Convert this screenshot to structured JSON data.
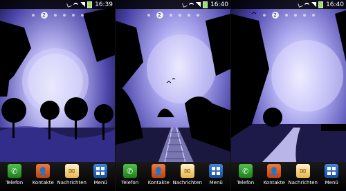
{
  "screens": [
    {
      "time": "16:39",
      "current_page": "2"
    },
    {
      "time": "16:40",
      "current_page": "2"
    },
    {
      "time": "16:40",
      "current_page": "2"
    }
  ],
  "dock": {
    "phone_label": "Telefon",
    "contacts_label": "Kontakte",
    "messages_label": "Nachrichten",
    "menu_label": "Menü"
  },
  "colors": {
    "sky": "#6a63c8",
    "moon_glow": "#e8e8ff",
    "phone_green": "#2e9b29",
    "contacts_orange": "#e0612a",
    "menu_blue": "#2a6ac4"
  },
  "icons": [
    "usb-icon",
    "wifi-icon",
    "signal-icon",
    "battery-icon",
    "phone-icon",
    "contacts-icon",
    "messages-icon",
    "menu-grid-icon"
  ]
}
